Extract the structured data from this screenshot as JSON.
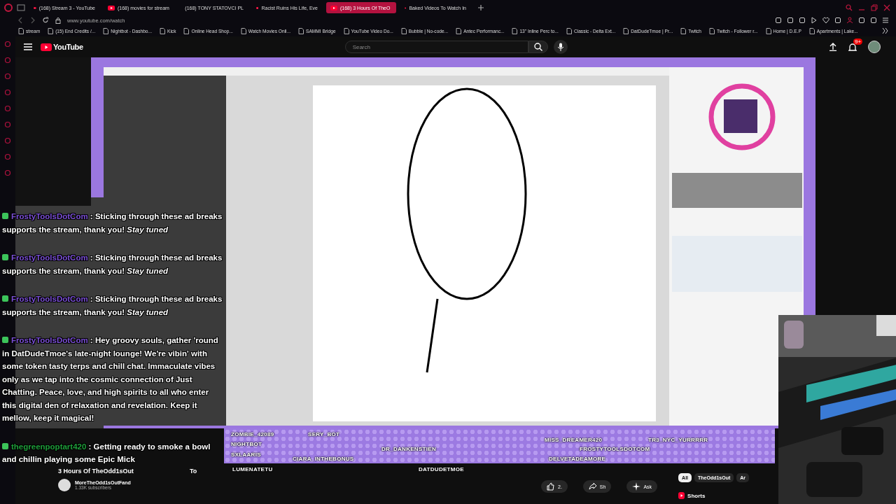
{
  "browser": {
    "tabs": [
      {
        "label": "(168) Stream 3 - YouTube",
        "selected": false
      },
      {
        "label": "(168) movies for stream",
        "selected": false
      },
      {
        "label": "(168) TONY STATOVCI PL",
        "selected": false
      },
      {
        "label": "Racist Ruins His Life, Eve",
        "selected": false
      },
      {
        "label": "(168) 3 Hours Of TheO",
        "selected": true
      },
      {
        "label": "Baked Videos To Watch In",
        "selected": false
      }
    ],
    "address": "www.youtube.com/watch",
    "bookmarks": [
      "stream",
      "(15) End Credits /...",
      "Nightbot - Dashbo...",
      "Kick",
      "Online Head Shop...",
      "Watch Movies Onli...",
      "SAMMI Bridge",
      "YouTube Video Do...",
      "Bubble | No-code...",
      "Antec Performanc...",
      "13\" Inline Perc to...",
      "Classic - Delta Ext...",
      "DatDudeTmoe | Pr...",
      "Twitch",
      "Twitch - Follower r...",
      "Home | D.E.P",
      "Apartments | Lake..."
    ]
  },
  "youtube": {
    "logo": "YouTube",
    "search": {
      "placeholder": "Search"
    },
    "notifications_badge": "9+"
  },
  "info": {
    "title": "3 Hours Of TheOdd1sOut",
    "title_end": "To",
    "channel": "MoreTheOdd1sOutFand",
    "subscribers": "1.33K subscribers",
    "actions": [
      "2.",
      "Sh",
      "Ask"
    ],
    "chips": [
      {
        "label": "All",
        "selected": true
      },
      {
        "label": "TheOdd1sOut",
        "selected": false
      },
      {
        "label": "Ar",
        "selected": false
      }
    ],
    "shelf_title": "Shorts"
  },
  "chat": [
    {
      "user": "FrostyToolsDotCom",
      "color": "#7b4fd6",
      "text": ": Sticking through these ad breaks supports the stream, thank you! *Stay tuned*"
    },
    {
      "user": "FrostyToolsDotCom",
      "color": "#7b4fd6",
      "text": ": Sticking through these ad breaks supports the stream, thank you! *Stay tuned*"
    },
    {
      "user": "FrostyToolsDotCom",
      "color": "#7b4fd6",
      "text": ": Sticking through these ad breaks supports the stream, thank you! *Stay tuned*"
    },
    {
      "user": "FrostyToolsDotCom",
      "color": "#7b4fd6",
      "text": ": Hey groovy souls, gather 'round in DatDudeTmoe's late-night lounge! We're vibin' with some token tasty terps and chill chat. Immaculate vibes only as we tap into the cosmic connection of Just Chatting. Peace, love, and high spirits to all who enter this digital den of relaxation and revelation. Keep it mellow, keep it magical!"
    },
    {
      "user": "thegreenpoptart420",
      "color": "#1e9e3a",
      "text": ": Getting ready to smoke a bowl and chillin playing some Epic Mick"
    }
  ],
  "overlay_names": [
    "ZOMBIE_42089",
    "SERY_BOT",
    "NIGHTBOT",
    "SXLAARIS",
    "CIARA_INTHEBONUS",
    "LUMENATETU",
    "DR_DANKENSTIEN",
    "DATDUDETMOE",
    "MISS_DREAMER420",
    "TR3_NYC_YURRRRR",
    "FROSTYTOOLSDOTCOM",
    "DELVETADEAMORE"
  ]
}
